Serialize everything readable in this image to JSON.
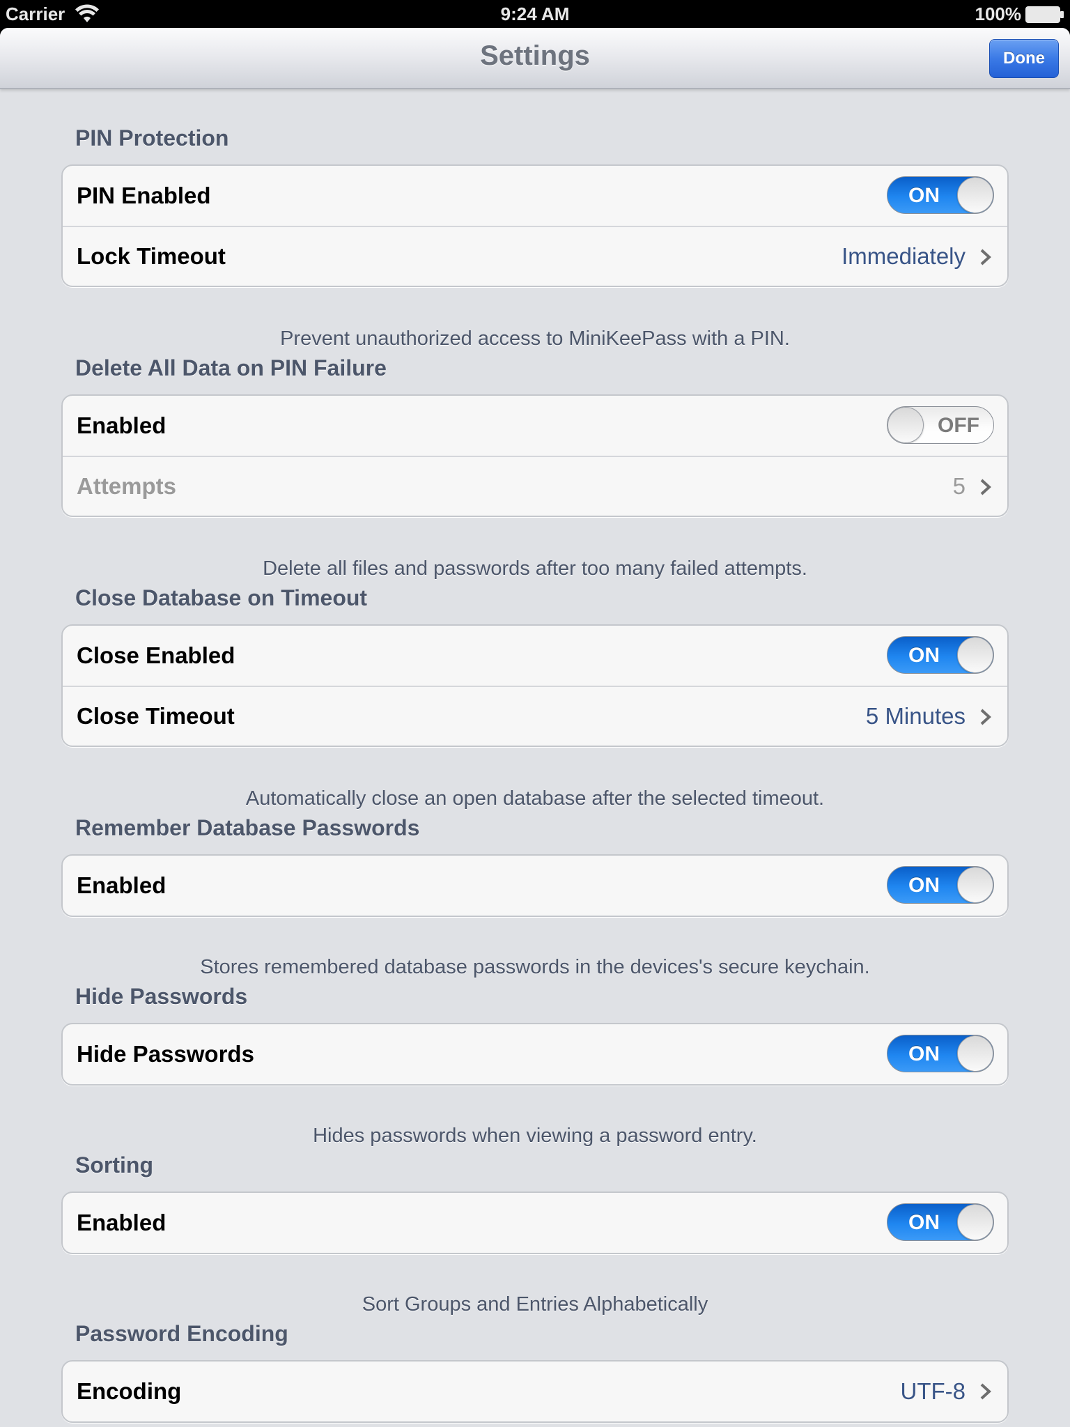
{
  "status_bar": {
    "carrier": "Carrier",
    "time": "9:24 AM",
    "battery": "100%"
  },
  "nav": {
    "title": "Settings",
    "done_label": "Done"
  },
  "sections": [
    {
      "header": "PIN Protection",
      "rows": [
        {
          "label": "PIN Enabled",
          "toggle": "ON"
        },
        {
          "label": "Lock Timeout",
          "value": "Immediately"
        }
      ],
      "footer": "Prevent unauthorized access to MiniKeePass with a PIN."
    },
    {
      "header": "Delete All Data on PIN Failure",
      "rows": [
        {
          "label": "Enabled",
          "toggle": "OFF"
        },
        {
          "label": "Attempts",
          "value": "5",
          "disabled": true
        }
      ],
      "footer": "Delete all files and passwords after too many failed attempts."
    },
    {
      "header": "Close Database on Timeout",
      "rows": [
        {
          "label": "Close Enabled",
          "toggle": "ON"
        },
        {
          "label": "Close Timeout",
          "value": "5 Minutes"
        }
      ],
      "footer": "Automatically close an open database after the selected timeout."
    },
    {
      "header": "Remember Database Passwords",
      "rows": [
        {
          "label": "Enabled",
          "toggle": "ON"
        }
      ],
      "footer": "Stores remembered database passwords in the devices's secure keychain."
    },
    {
      "header": "Hide Passwords",
      "rows": [
        {
          "label": "Hide Passwords",
          "toggle": "ON"
        }
      ],
      "footer": "Hides passwords when viewing a password entry."
    },
    {
      "header": "Sorting",
      "rows": [
        {
          "label": "Enabled",
          "toggle": "ON"
        }
      ],
      "footer": "Sort Groups and Entries Alphabetically"
    },
    {
      "header": "Password Encoding",
      "rows": [
        {
          "label": "Encoding",
          "value": "UTF-8"
        }
      ],
      "footer": ""
    }
  ],
  "icons": {
    "wifi": "wifi-icon",
    "battery": "battery-icon",
    "chevron": "chevron-right-icon"
  },
  "colors": {
    "accent_blue": "#1f86f0",
    "value_text": "#385487",
    "header_text": "#4c566a",
    "background": "#dfe1e5"
  }
}
